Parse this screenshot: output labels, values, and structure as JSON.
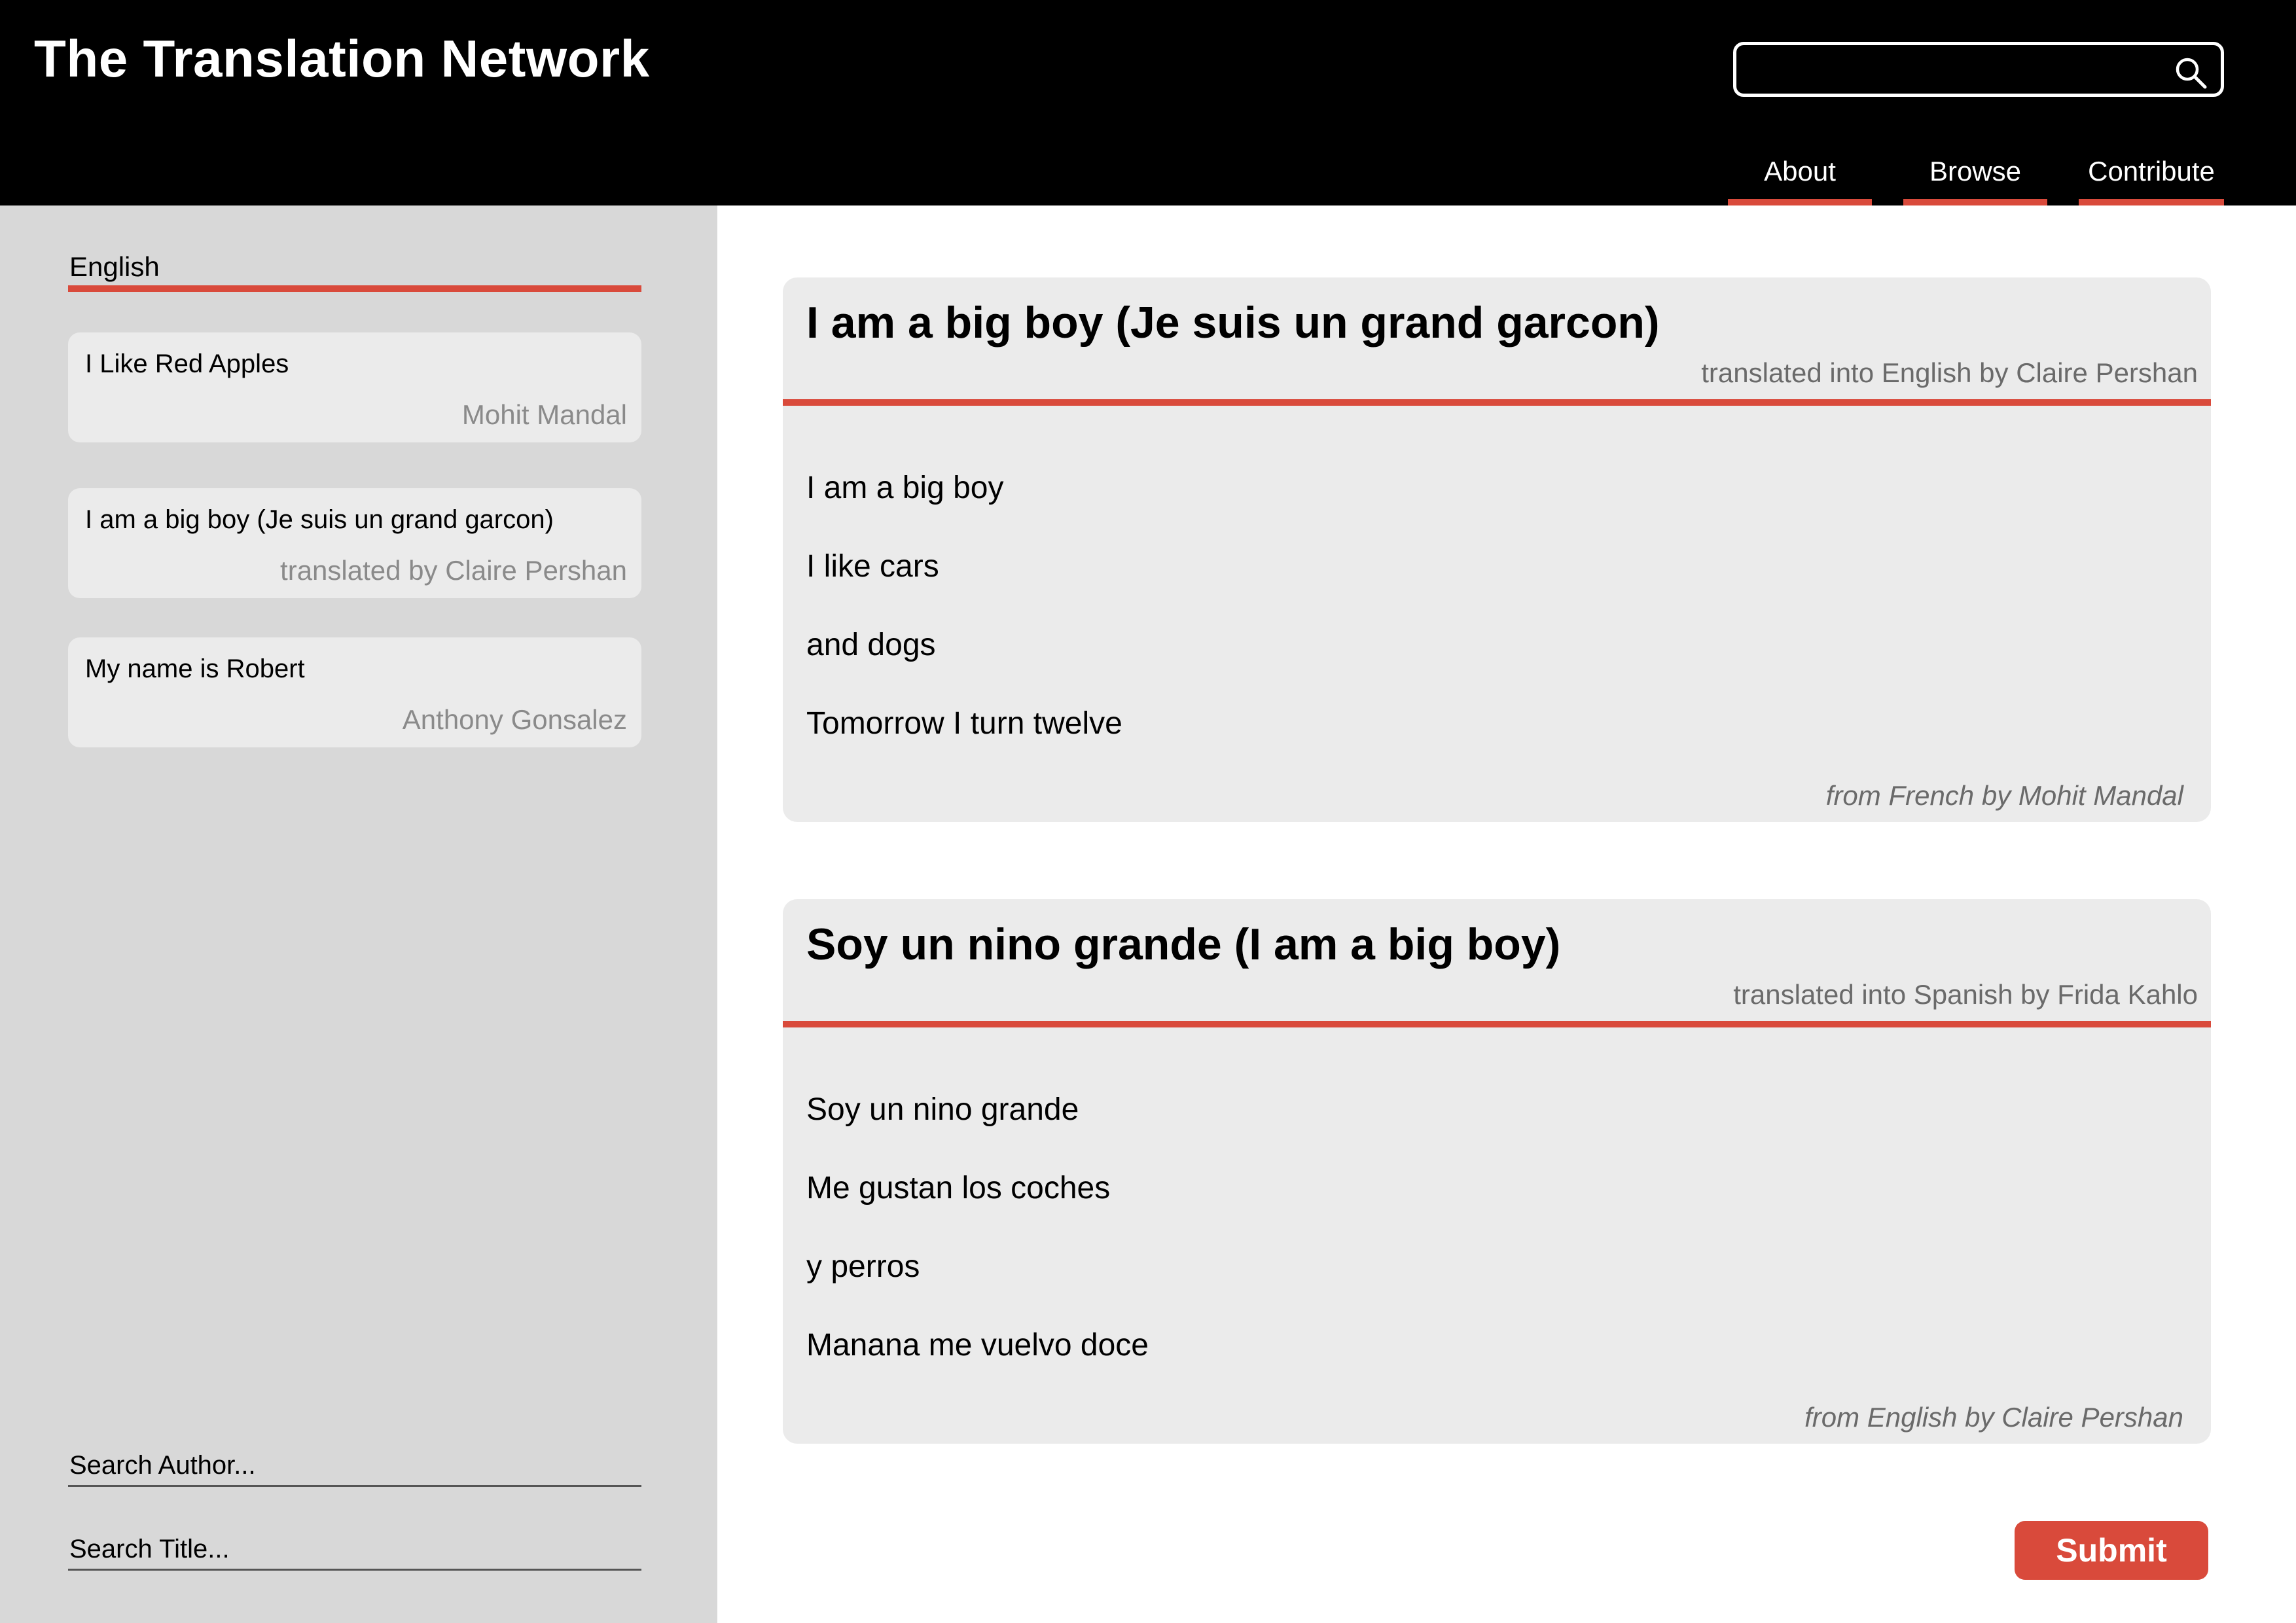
{
  "app": {
    "title": "The Translation Network"
  },
  "header": {
    "search": {
      "value": "",
      "icon": "search-icon"
    },
    "nav": [
      {
        "label": "About"
      },
      {
        "label": "Browse"
      },
      {
        "label": "Contribute"
      }
    ]
  },
  "sidebar": {
    "language": "English",
    "items": [
      {
        "title": "I Like Red Apples",
        "author": "Mohit Mandal"
      },
      {
        "title": "I am a big boy (Je suis un grand garcon)",
        "author": "translated by Claire Pershan"
      },
      {
        "title": "My name is Robert",
        "author": "Anthony Gonsalez"
      }
    ],
    "search_author_placeholder": "Search Author...",
    "search_title_placeholder": "Search Title..."
  },
  "main": {
    "translations": [
      {
        "title": "I am a big boy (Je suis un grand garcon)",
        "translator": "translated into English by Claire Pershan",
        "lines": [
          "I am a big boy",
          "I like cars",
          "and dogs",
          "Tomorrow I turn twelve"
        ],
        "source": "from French by Mohit Mandal"
      },
      {
        "title": "Soy un nino grande (I am a big boy)",
        "translator": "translated into Spanish by Frida Kahlo",
        "lines": [
          "Soy un nino grande",
          "Me gustan los coches",
          "y perros",
          "Manana me vuelvo doce"
        ],
        "source": "from English by Claire Pershan"
      }
    ],
    "submit_label": "Submit"
  },
  "colors": {
    "header_bg": "#000000",
    "accent": "#d94a3b",
    "sidebar_bg": "#d8d8d8",
    "card_bg": "#ebebeb",
    "muted_text": "#8a8a8a"
  }
}
